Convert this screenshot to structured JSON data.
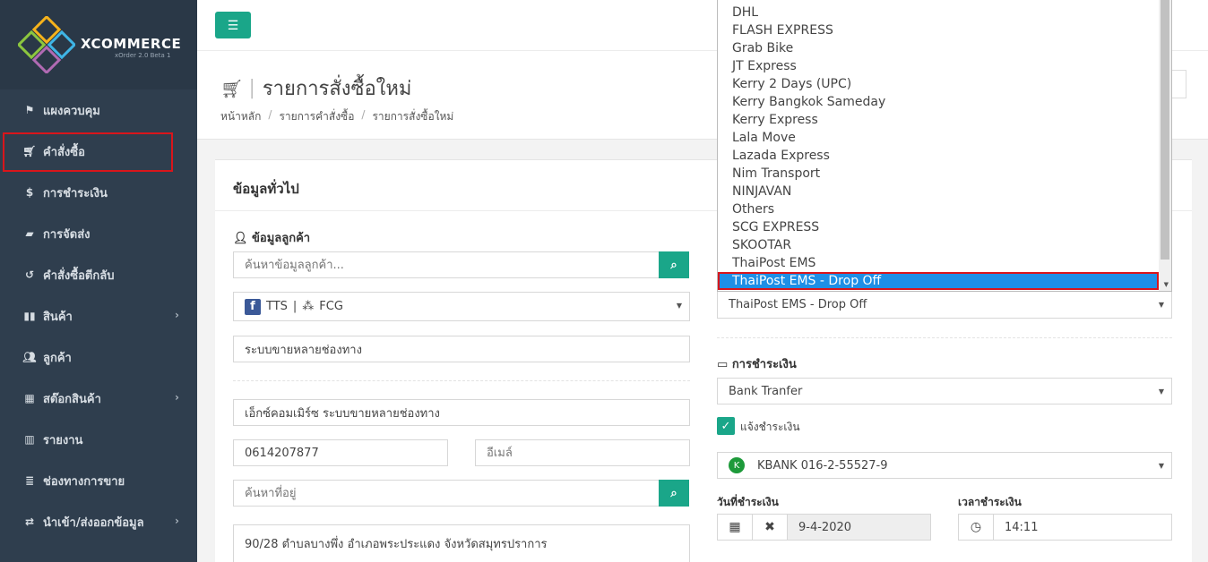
{
  "brand": {
    "name": "XCOMMERCE",
    "sub": "xOrder 2.0 Beta 1"
  },
  "sidebar": {
    "items": [
      {
        "label": "แผงควบคุม",
        "icon": "flag-icon"
      },
      {
        "label": "คำสั่งซื้อ",
        "icon": "cart-icon"
      },
      {
        "label": "การชำระเงิน",
        "icon": "dollar-icon"
      },
      {
        "label": "การจัดส่ง",
        "icon": "truck-icon"
      },
      {
        "label": "คำสั่งซื้อตีกลับ",
        "icon": "undo-icon"
      },
      {
        "label": "สินค้า",
        "icon": "barcode-icon"
      },
      {
        "label": "ลูกค้า",
        "icon": "users-icon"
      },
      {
        "label": "สต๊อกสินค้า",
        "icon": "cubes-icon"
      },
      {
        "label": "รายงาน",
        "icon": "bar-chart-icon"
      },
      {
        "label": "ช่องทางการขาย",
        "icon": "server-icon"
      },
      {
        "label": "นำเข้า/ส่งออกข้อมูล",
        "icon": "exchange-icon"
      }
    ]
  },
  "header": {
    "title": "รายการสั่งซื้อใหม่",
    "breadcrumb": [
      "หน้าหลัก",
      "รายการคำสั่งซื้อ",
      "รายการสั่งซื้อใหม่"
    ]
  },
  "panel": {
    "title": "ข้อมูลทั่วไป",
    "customer_label": "ข้อมูลลูกค้า",
    "customer_search_placeholder": "ค้นหาข้อมูลลูกค้า...",
    "channel_page": "TTS",
    "channel_sep": "|",
    "channel_store": "FCG",
    "sales_channel": "ระบบขายหลายช่องทาง",
    "customer_name": "เอ็กซ์คอมเมิร์ซ ระบบขายหลายช่องทาง",
    "phone": "0614207877",
    "email_placeholder": "อีเมล์",
    "address_search_placeholder": "ค้นหาที่อยู่",
    "address": "90/28 ตำบลบางพึ่ง อำเภอพระประแดง จังหวัดสมุทรปราการ"
  },
  "shipping": {
    "options": [
      "DHL",
      "FLASH EXPRESS",
      "Grab Bike",
      "JT Express",
      "Kerry 2 Days (UPC)",
      "Kerry Bangkok Sameday",
      "Kerry Express",
      "Lala Move",
      "Lazada Express",
      "Nim Transport",
      "NINJAVAN",
      "Others",
      "SCG EXPRESS",
      "SKOOTAR",
      "ThaiPost EMS",
      "ThaiPost EMS - Drop Off"
    ],
    "selected": "ThaiPost EMS - Drop Off"
  },
  "payment": {
    "label": "การชำระเงิน",
    "method": "Bank Tranfer",
    "notify_label": "แจ้งชำระเงิน",
    "bank_account": "KBANK 016-2-55527-9",
    "date_label": "วันที่ชำระเงิน",
    "date_value": "9-4-2020",
    "time_label": "เวลาชำระเงิน",
    "time_value": "14:11"
  }
}
